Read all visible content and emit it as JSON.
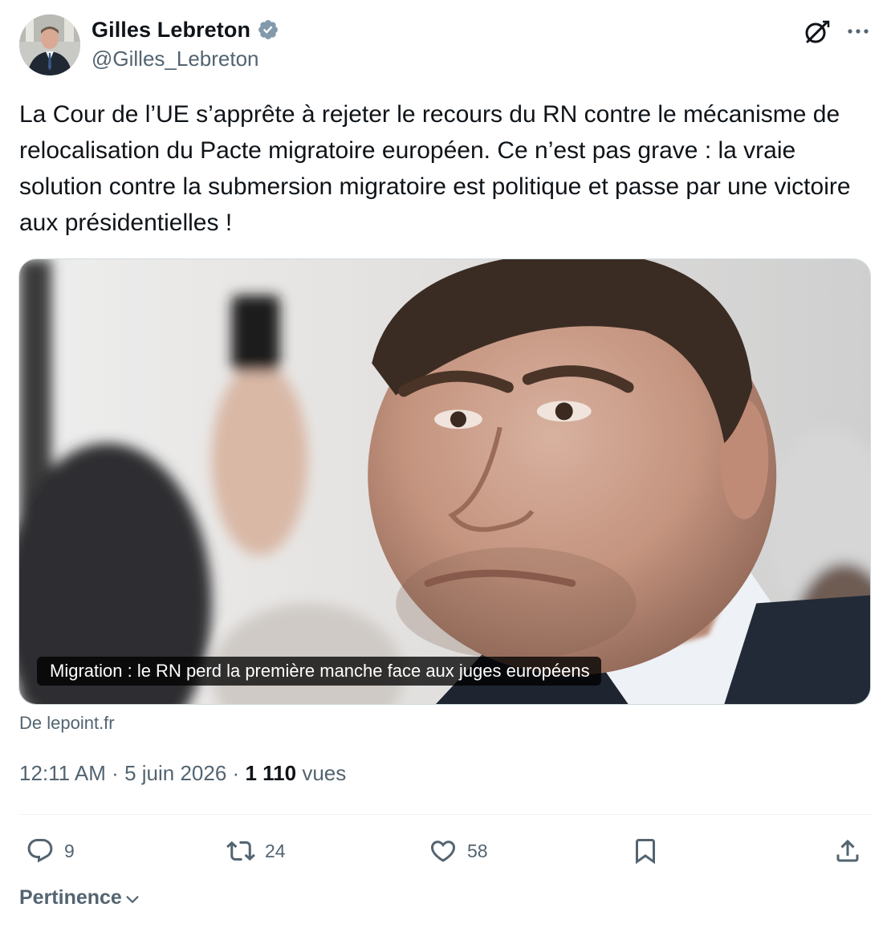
{
  "author": {
    "name": "Gilles Lebreton",
    "handle": "@Gilles_Lebreton",
    "verified": true,
    "verified_color": "#829aab"
  },
  "header_icons": [
    "grok-icon",
    "more-icon"
  ],
  "tweet": {
    "text": "La Cour de l’UE s’apprête à rejeter le recours du RN contre le mécanisme de relocalisation du Pacte migratoire européen. Ce n’est pas grave : la vraie solution contre la submersion migratoire est politique et passe par une victoire aux présidentielles !"
  },
  "card": {
    "caption": "Migration : le RN perd la première manche face aux juges européens",
    "source": "De lepoint.fr"
  },
  "meta": {
    "time": "12:11 AM",
    "separator": "·",
    "date": "5 juin 2026",
    "views_count": "1 110",
    "views_label": "vues"
  },
  "actions": {
    "reply": {
      "icon": "reply-icon",
      "count": "9"
    },
    "retweet": {
      "icon": "retweet-icon",
      "count": "24"
    },
    "like": {
      "icon": "heart-icon",
      "count": "58"
    },
    "bookmark": {
      "icon": "bookmark-icon"
    },
    "share": {
      "icon": "share-icon"
    }
  },
  "sort": {
    "label": "Pertinence",
    "icon": "chevron-down-icon"
  },
  "colors": {
    "text": "#0f1419",
    "secondary": "#536471",
    "border": "#cfd9de",
    "divider": "#eff3f4"
  }
}
